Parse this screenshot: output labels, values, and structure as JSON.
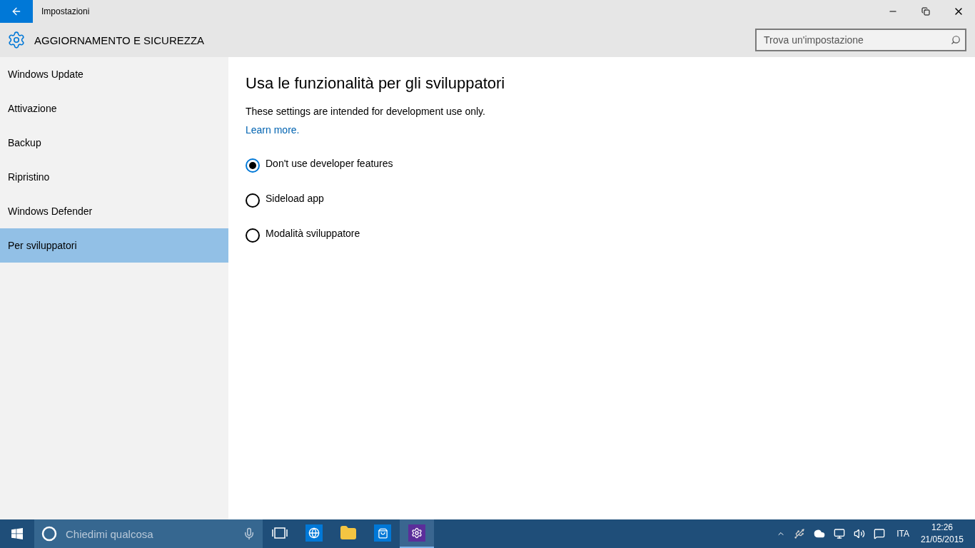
{
  "window": {
    "title": "Impostazioni"
  },
  "header": {
    "title": "AGGIORNAMENTO E SICUREZZA"
  },
  "search": {
    "placeholder": "Trova un'impostazione"
  },
  "sidebar": {
    "items": [
      {
        "label": "Windows Update",
        "selected": false
      },
      {
        "label": "Attivazione",
        "selected": false
      },
      {
        "label": "Backup",
        "selected": false
      },
      {
        "label": "Ripristino",
        "selected": false
      },
      {
        "label": "Windows Defender",
        "selected": false
      },
      {
        "label": "Per sviluppatori",
        "selected": true
      }
    ]
  },
  "content": {
    "title": "Usa le funzionalità per gli sviluppatori",
    "description": "These settings are intended for development use only.",
    "link": "Learn more.",
    "options": [
      {
        "label": "Don't use developer features",
        "selected": true
      },
      {
        "label": "Sideload app",
        "selected": false
      },
      {
        "label": "Modalità sviluppatore",
        "selected": false
      }
    ]
  },
  "taskbar": {
    "search_placeholder": "Chiedimi qualcosa",
    "apps": [
      {
        "kind": "browser",
        "selected": false
      },
      {
        "kind": "explorer",
        "selected": false
      },
      {
        "kind": "store",
        "selected": false
      },
      {
        "kind": "settings",
        "selected": true
      }
    ],
    "language": "ITA",
    "time": "12:26",
    "date": "21/05/2015"
  }
}
